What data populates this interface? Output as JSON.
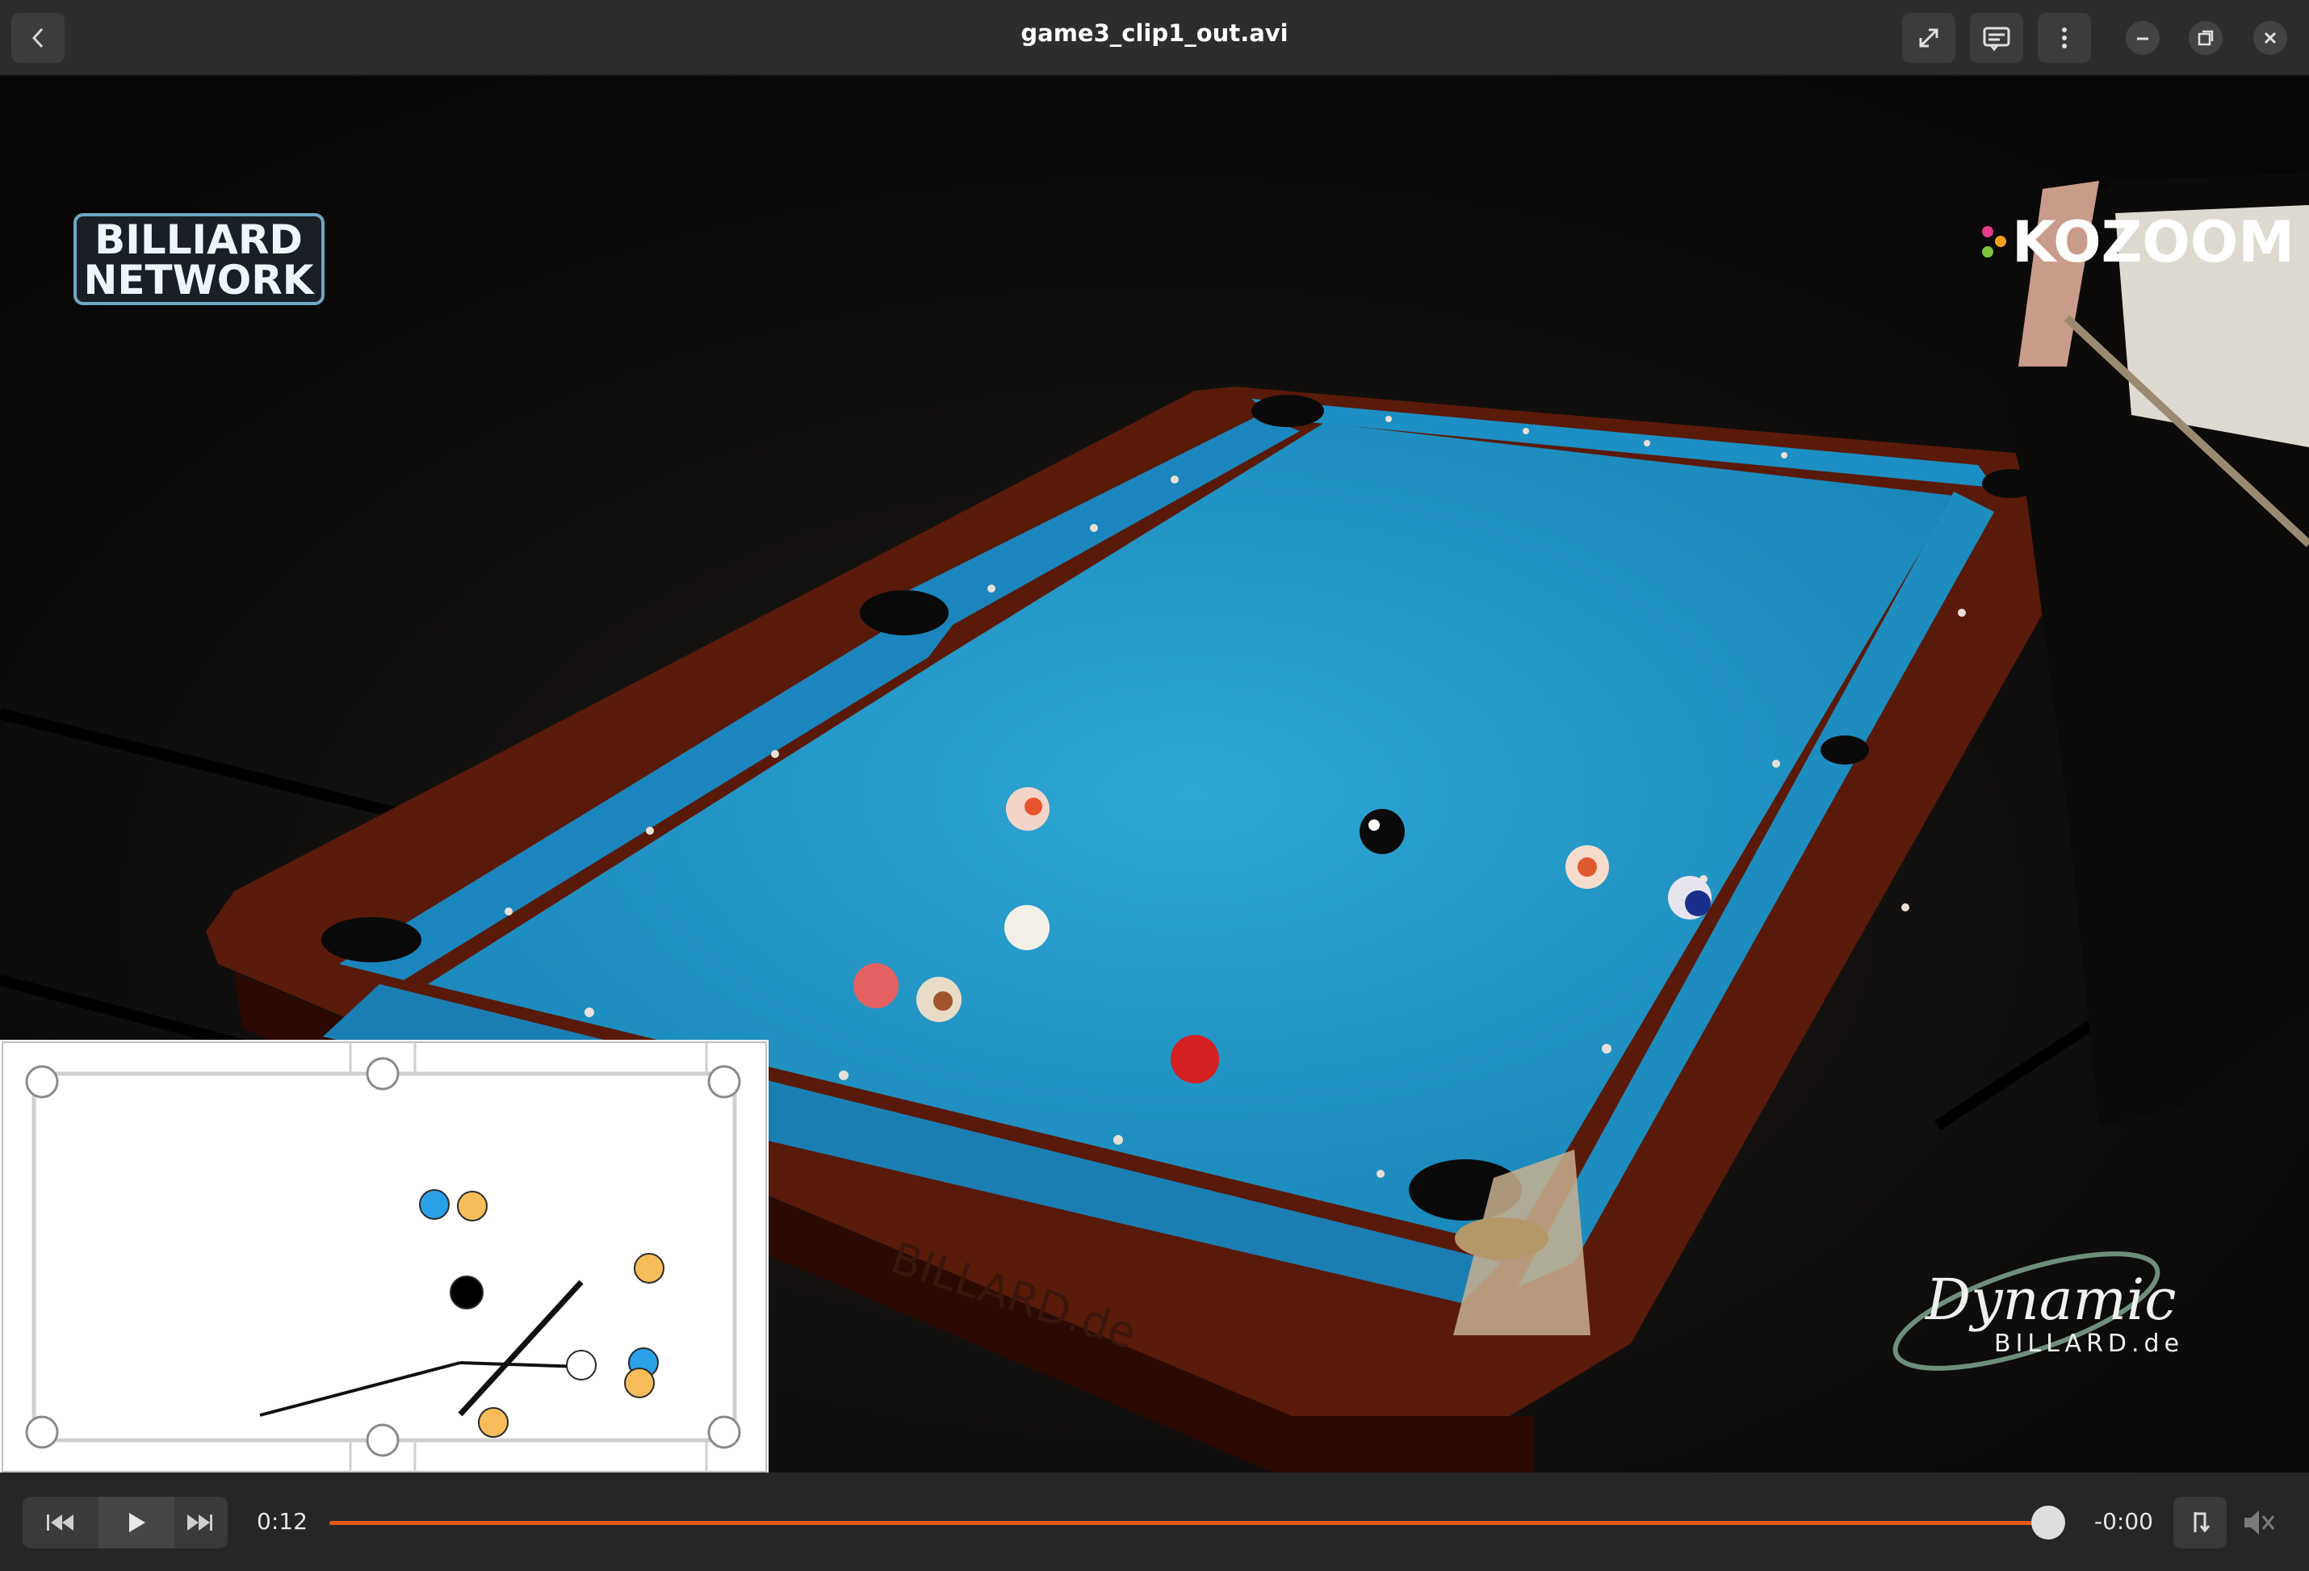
{
  "window": {
    "title": "game3_clip1_out.avi"
  },
  "header": {
    "icons": [
      "back-icon",
      "fullscreen-icon",
      "subtitles-icon",
      "menu-icon",
      "minimize-icon",
      "restore-icon",
      "close-icon"
    ]
  },
  "video": {
    "logo_left_line1": "BILLIARD",
    "logo_left_line2": "NETWORK",
    "logo_right": "KOZOOM",
    "sponsor_line1": "Dynamic",
    "sponsor_line2": "BILLARD.de",
    "table_side_text": "BILLARD.de"
  },
  "controls": {
    "elapsed": "0:12",
    "remaining": "-0:00",
    "progress": 0.99,
    "accent": "#e35a1c"
  }
}
